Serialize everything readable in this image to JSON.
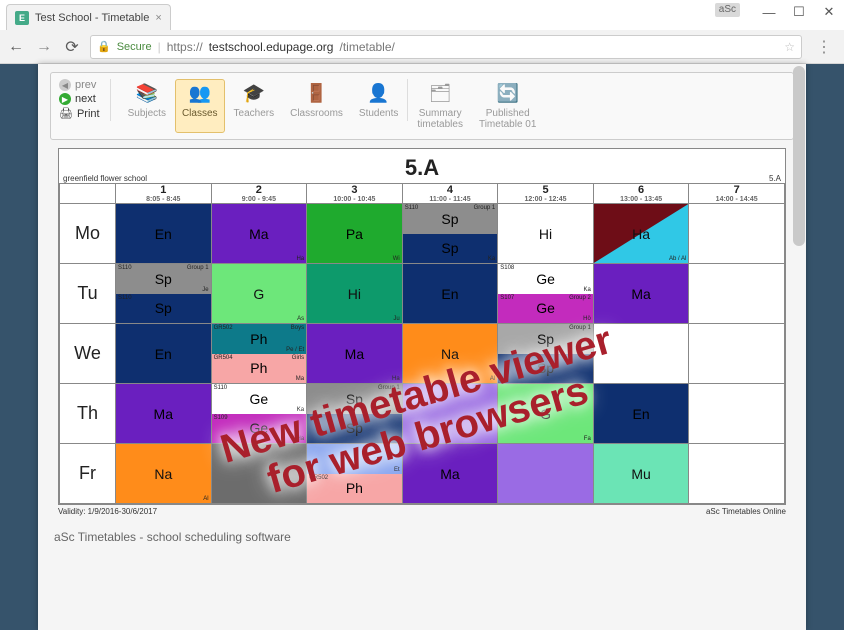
{
  "browser": {
    "tab_title": "Test School - Timetable",
    "tab_favicon_letter": "E",
    "badge": "aSc",
    "secure_label": "Secure",
    "url_scheme": "https://",
    "url_host": "testschool.edupage.org",
    "url_path": "/timetable/"
  },
  "toolbar": {
    "prev": "prev",
    "next": "next",
    "print": "Print",
    "items": [
      {
        "label": "Subjects",
        "icon": "📚"
      },
      {
        "label": "Classes",
        "icon": "👥",
        "active": true
      },
      {
        "label": "Teachers",
        "icon": "🎓"
      },
      {
        "label": "Classrooms",
        "icon": "🚪"
      },
      {
        "label": "Students",
        "icon": "👤"
      },
      {
        "label": "Summary\ntimetables",
        "icon": "🗂"
      },
      {
        "label": "Published\nTimetable 01",
        "icon": "🔄"
      }
    ]
  },
  "timetable": {
    "title": "5.A",
    "school": "greenfield flower school",
    "class_label": "5.A",
    "periods": [
      {
        "n": "1",
        "time": "8:05 - 8:45"
      },
      {
        "n": "2",
        "time": "9:00 - 9:45"
      },
      {
        "n": "3",
        "time": "10:00 - 10:45"
      },
      {
        "n": "4",
        "time": "11:00 - 11:45"
      },
      {
        "n": "5",
        "time": "12:00 - 12:45"
      },
      {
        "n": "6",
        "time": "13:00 - 13:45"
      },
      {
        "n": "7",
        "time": "14:00 - 14:45"
      }
    ],
    "days": [
      "Mo",
      "Tu",
      "We",
      "Th",
      "Fr"
    ],
    "mo": {
      "p1": {
        "sub": "En"
      },
      "p2": {
        "sub": "Ma",
        "br": "Ha"
      },
      "p3": {
        "sub": "Pa",
        "br": "Wi"
      },
      "p4a": {
        "sub": "Sp",
        "tr": "Group 1",
        "tl": "S110"
      },
      "p4b": {
        "sub": "Sp",
        "br": "Ka"
      },
      "p5": {
        "sub": "Hi"
      },
      "p6": {
        "sub": "Ha",
        "br": "Ab / Al"
      }
    },
    "tu": {
      "p1a": {
        "sub": "Sp",
        "tr": "Group 1",
        "tl": "S110",
        "br": "Je"
      },
      "p1b": {
        "sub": "Sp",
        "tl": "S110"
      },
      "p2": {
        "sub": "G",
        "br": "As"
      },
      "p3": {
        "sub": "Hi",
        "br": "Ju"
      },
      "p4": {
        "sub": "En"
      },
      "p5a": {
        "sub": "Ge",
        "tl": "S108",
        "br": "Ka"
      },
      "p5b": {
        "sub": "Ge",
        "tl": "S107",
        "tr": "Group 2",
        "br": "Hö"
      },
      "p6": {
        "sub": "Ma"
      }
    },
    "we": {
      "p1": {
        "sub": "En"
      },
      "p2a": {
        "sub": "Ph",
        "tl": "GR502",
        "tr": "Boys",
        "br": "Pe / Et"
      },
      "p2b": {
        "sub": "Ph",
        "tl": "GR504",
        "tr": "Girls",
        "br": "Ma"
      },
      "p3": {
        "sub": "Ma",
        "br": "Ha"
      },
      "p4": {
        "sub": "Na",
        "br": "Al"
      },
      "p5a": {
        "sub": "Sp",
        "tr": "Group 1"
      },
      "p5b": {
        "sub": "Sp"
      }
    },
    "th": {
      "p1": {
        "sub": "Ma"
      },
      "p2a": {
        "sub": "Ge",
        "tl": "S110",
        "br": "Ka"
      },
      "p2b": {
        "sub": "Ge",
        "tl": "S109",
        "br": "Ha"
      },
      "p3a": {
        "sub": "Sp",
        "tr": "Group 1"
      },
      "p3b": {
        "sub": "Sp"
      },
      "p5": {
        "sub": "G",
        "br": "Fa"
      },
      "p6": {
        "sub": "En"
      }
    },
    "fr": {
      "p1": {
        "sub": "Na",
        "br": "Al"
      },
      "p3a": {
        "br": "Et"
      },
      "p3b": {
        "sub": "Ph",
        "tl": "GR502"
      },
      "p4": {
        "sub": "Ma"
      },
      "p6": {
        "sub": "Mu"
      }
    },
    "validity": "Validity: 1/9/2016-30/6/2017",
    "brand": "aSc Timetables Online"
  },
  "footer": "aSc Timetables - school scheduling software",
  "overlay": {
    "line1": "New timetable viewer",
    "line2": "for web browsers"
  }
}
